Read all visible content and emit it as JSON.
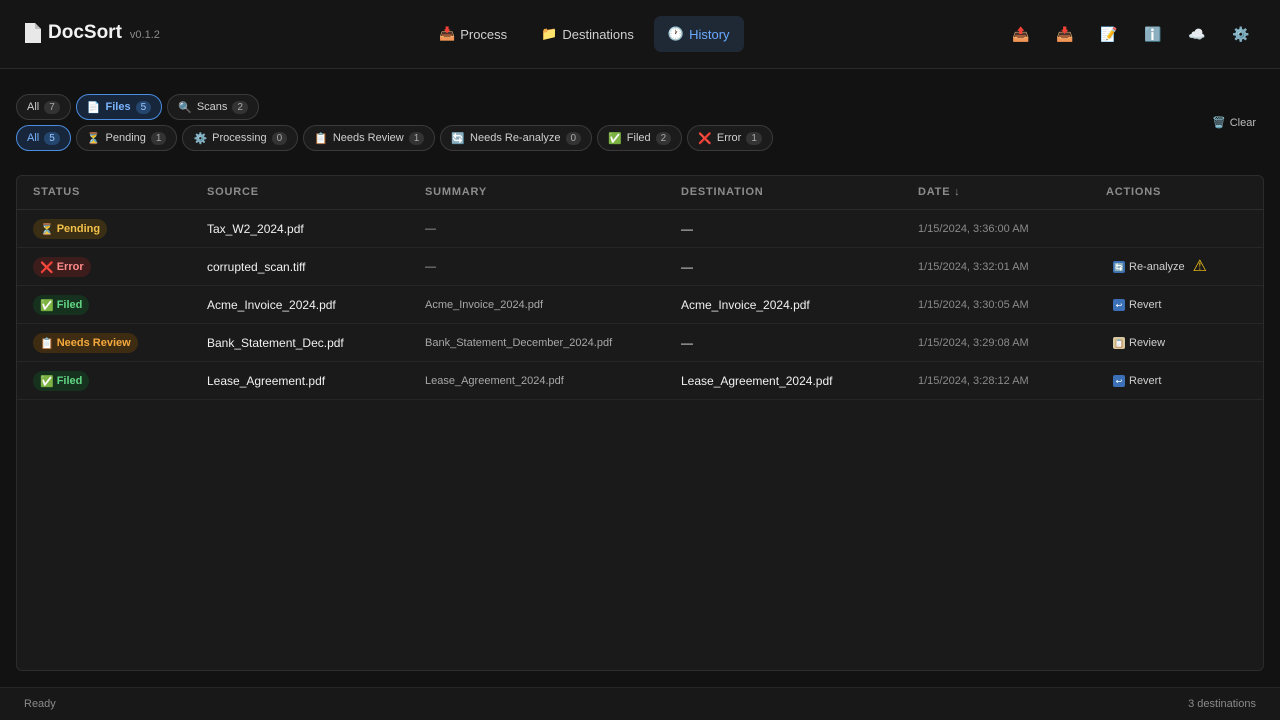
{
  "app": {
    "title": "DocSort",
    "version": "v0.1.2"
  },
  "nav": [
    {
      "icon": "📥",
      "label": "Process"
    },
    {
      "icon": "📁",
      "label": "Destinations"
    },
    {
      "icon": "🕐",
      "label": "History"
    }
  ],
  "tools": [
    "📤",
    "📥",
    "📝",
    "ℹ️",
    "☁️",
    "⚙️"
  ],
  "type_filters": [
    {
      "icon": "",
      "label": "All",
      "count": "7"
    },
    {
      "icon": "📄",
      "label": "Files",
      "count": "5"
    },
    {
      "icon": "🔍",
      "label": "Scans",
      "count": "2"
    }
  ],
  "status_filters": [
    {
      "icon": "",
      "label": "All",
      "count": "5"
    },
    {
      "icon": "⏳",
      "label": "Pending",
      "count": "1"
    },
    {
      "icon": "⚙️",
      "label": "Processing",
      "count": "0"
    },
    {
      "icon": "📋",
      "label": "Needs Review",
      "count": "1"
    },
    {
      "icon": "🔄",
      "label": "Needs Re-analyze",
      "count": "0"
    },
    {
      "icon": "✅",
      "label": "Filed",
      "count": "2"
    },
    {
      "icon": "❌",
      "label": "Error",
      "count": "1"
    }
  ],
  "clear": {
    "icon": "🗑️",
    "label": "Clear"
  },
  "table": {
    "headers": {
      "status": "STATUS",
      "source": "SOURCE",
      "summary": "SUMMARY",
      "destination": "DESTINATION",
      "date": "DATE ↓",
      "actions": "ACTIONS"
    },
    "rows": [
      {
        "status_icon": "⏳",
        "status": "Pending",
        "source": "Tax_W2_2024.pdf",
        "summary": "—",
        "destination": "—",
        "date": "1/15/2024, 3:36:00 AM",
        "action_icon": "",
        "action": ""
      },
      {
        "status_icon": "❌",
        "status": "Error",
        "source": "corrupted_scan.tiff",
        "summary": "—",
        "destination": "—",
        "date": "1/15/2024, 3:32:01 AM",
        "action_icon": "🔄",
        "action": "Re-analyze",
        "warning": "⚠"
      },
      {
        "status_icon": "✅",
        "status": "Filed",
        "source": "Acme_Invoice_2024.pdf",
        "summary": "Acme_Invoice_2024.pdf",
        "destination": "Acme_Invoice_2024.pdf",
        "date": "1/15/2024, 3:30:05 AM",
        "action_icon": "↩",
        "action": "Revert"
      },
      {
        "status_icon": "📋",
        "status": "Needs Review",
        "source": "Bank_Statement_Dec.pdf",
        "summary": "Bank_Statement_December_2024.pdf",
        "destination": "—",
        "date": "1/15/2024, 3:29:08 AM",
        "action_icon": "📋",
        "action": "Review"
      },
      {
        "status_icon": "✅",
        "status": "Filed",
        "source": "Lease_Agreement.pdf",
        "summary": "Lease_Agreement_2024.pdf",
        "destination": "Lease_Agreement_2024.pdf",
        "date": "1/15/2024, 3:28:12 AM",
        "action_icon": "↩",
        "action": "Revert"
      }
    ]
  },
  "statusbar": {
    "left": "Ready",
    "right": "3 destinations"
  }
}
